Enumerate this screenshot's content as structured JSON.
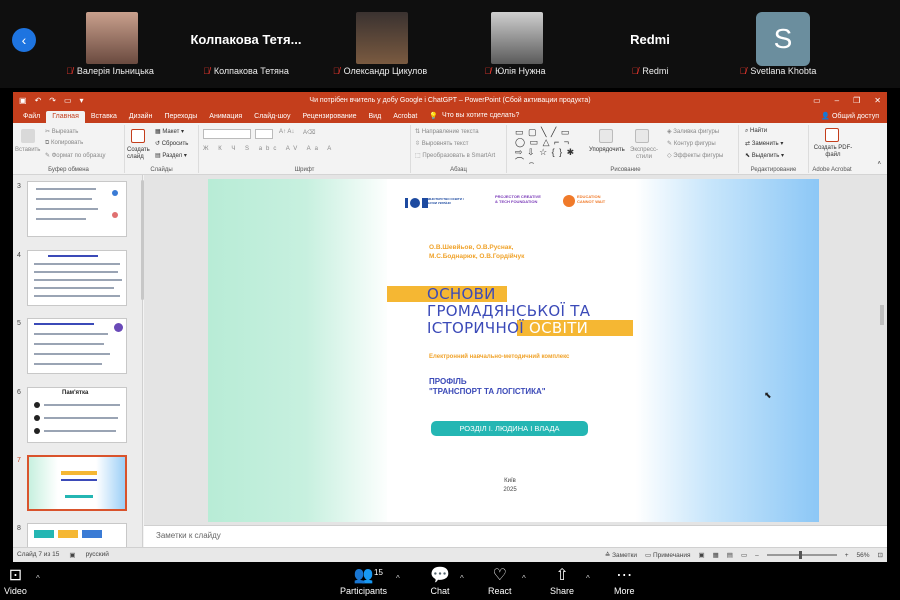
{
  "participants": [
    {
      "name": "Валерія Ільницька",
      "photo_color": "#8a5a4a",
      "big_name": ""
    },
    {
      "name": "Колпакова Тетяна",
      "photo_color": "",
      "big_name": "Колпакова  Тетя..."
    },
    {
      "name": "Олександр Цикулов",
      "photo_color": "#5a4030",
      "big_name": ""
    },
    {
      "name": "Юлія Нужна",
      "photo_color": "#8c8c8c",
      "big_name": ""
    },
    {
      "name": "Redmi",
      "photo_color": "",
      "big_name": "Redmi"
    },
    {
      "name": "Svetlana Khobta",
      "photo_color": "",
      "big_name": "",
      "avatar_letter": "S"
    }
  ],
  "ppt": {
    "title": "Чи потрібен вчитель у добу Google і ChatGPT – PowerPoint (Сбой активации продукта)",
    "tabs": [
      "Файл",
      "Главная",
      "Вставка",
      "Дизайн",
      "Переходы",
      "Анимация",
      "Слайд-шоу",
      "Рецензирование",
      "Вид",
      "Acrobat"
    ],
    "tell_me": "Что вы хотите сделать?",
    "share": "Общий доступ",
    "ribbon": {
      "insert_label": "Вставить",
      "cut": "Вырезать",
      "copy": "Копировать",
      "format_painter": "Формат по образцу",
      "clipboard_group": "Буфер обмена",
      "new_slide": "Создать слайд",
      "layout": "Макет",
      "reset": "Сбросить",
      "section": "Раздел",
      "slides_group": "Слайды",
      "font_group": "Шрифт",
      "text_direction": "Направление текста",
      "align_text": "Выровнять текст",
      "smartart": "Преобразовать в SmartArt",
      "paragraph_group": "Абзац",
      "arrange": "Упорядочить",
      "quick_styles": "Экспресс-стили",
      "shape_fill": "Заливка фигуры",
      "shape_outline": "Контур фигуры",
      "shape_effects": "Эффекты фигуры",
      "drawing_group": "Рисование",
      "find": "Найти",
      "replace": "Заменить",
      "select": "Выделить",
      "editing_group": "Редактирование",
      "create_pdf": "Создать PDF-файл",
      "acrobat_group": "Adobe Acrobat"
    },
    "thumbnails": [
      {
        "num": "3"
      },
      {
        "num": "4"
      },
      {
        "num": "5"
      },
      {
        "num": "6",
        "heading": "Пам'ятка"
      },
      {
        "num": "7"
      },
      {
        "num": "8"
      }
    ],
    "slide": {
      "logo1": "МІНІСТЕРСТВО ОСВІТИ І НАУКИ УКРАЇНИ",
      "logo2": "PROJECTOR CREATIVE & TECH FOUNDATION",
      "logo3": "EDUCATION CANNOT WAIT",
      "authors_1": "О.В.Шевйьов, О.В.Руснак,",
      "authors_2": "М.С.Боднарюк, О.В.Гордійчук",
      "title_1": "ОСНОВИ",
      "title_2": "ГРОМАДЯНСЬКОЇ ТА",
      "title_3a": "ІСТОРИЧНОЇ ",
      "title_3b": "ОСВІТИ",
      "subtitle": "Електронний навчально-методичний комплекс",
      "profile_1": "ПРОФІЛЬ",
      "profile_2": "\"ТРАНСПОРТ ТА ЛОГІСТИКА\"",
      "section_pill": "РОЗДІЛ І. ЛЮДИНА І ВЛАДА",
      "city": "Київ",
      "year": "2025"
    },
    "notes_placeholder": "Заметки к слайду",
    "status": {
      "slide_info": "Слайд 7 из 15",
      "language": "русский",
      "notes_btn": "Заметки",
      "comments_btn": "Примечания",
      "zoom": "56%"
    }
  },
  "toolbar": {
    "video": "Video",
    "participants": "Participants",
    "participants_count": "15",
    "chat": "Chat",
    "react": "React",
    "share": "Share",
    "more": "More"
  }
}
